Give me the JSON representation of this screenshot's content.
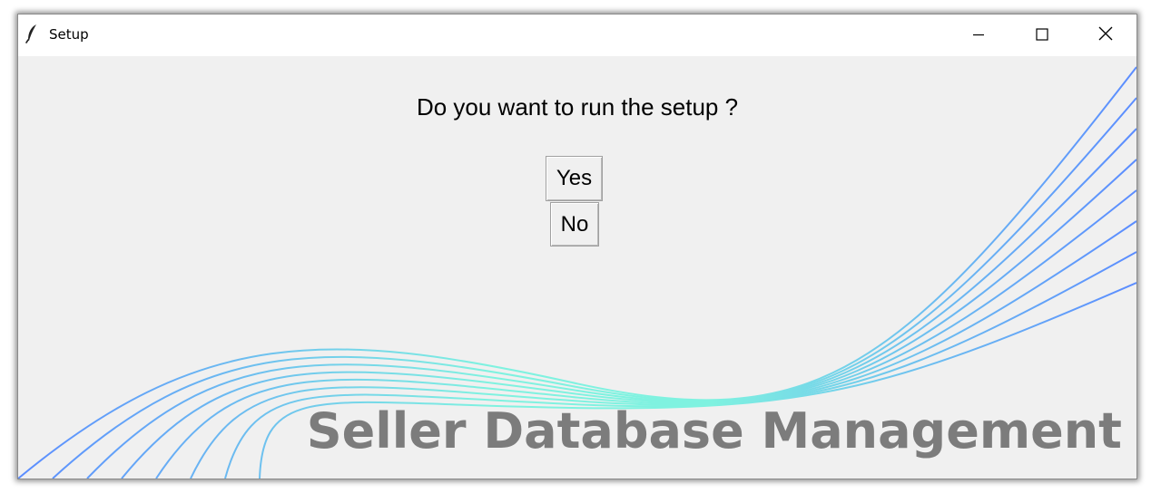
{
  "window": {
    "title": "Setup",
    "app_icon": "feather-icon",
    "controls": {
      "minimize": "minimize-icon",
      "maximize": "maximize-icon",
      "close": "close-icon"
    }
  },
  "dialog": {
    "prompt": "Do you want to run the setup ?",
    "yes_label": "Yes",
    "no_label": "No"
  },
  "branding": {
    "text": "Seller Database Management"
  },
  "colors": {
    "wave_blue": "#5b8cff",
    "wave_cyan": "#7ff2e0",
    "client_bg": "#f0f0f0",
    "brand_text": "#7c7c7c"
  }
}
